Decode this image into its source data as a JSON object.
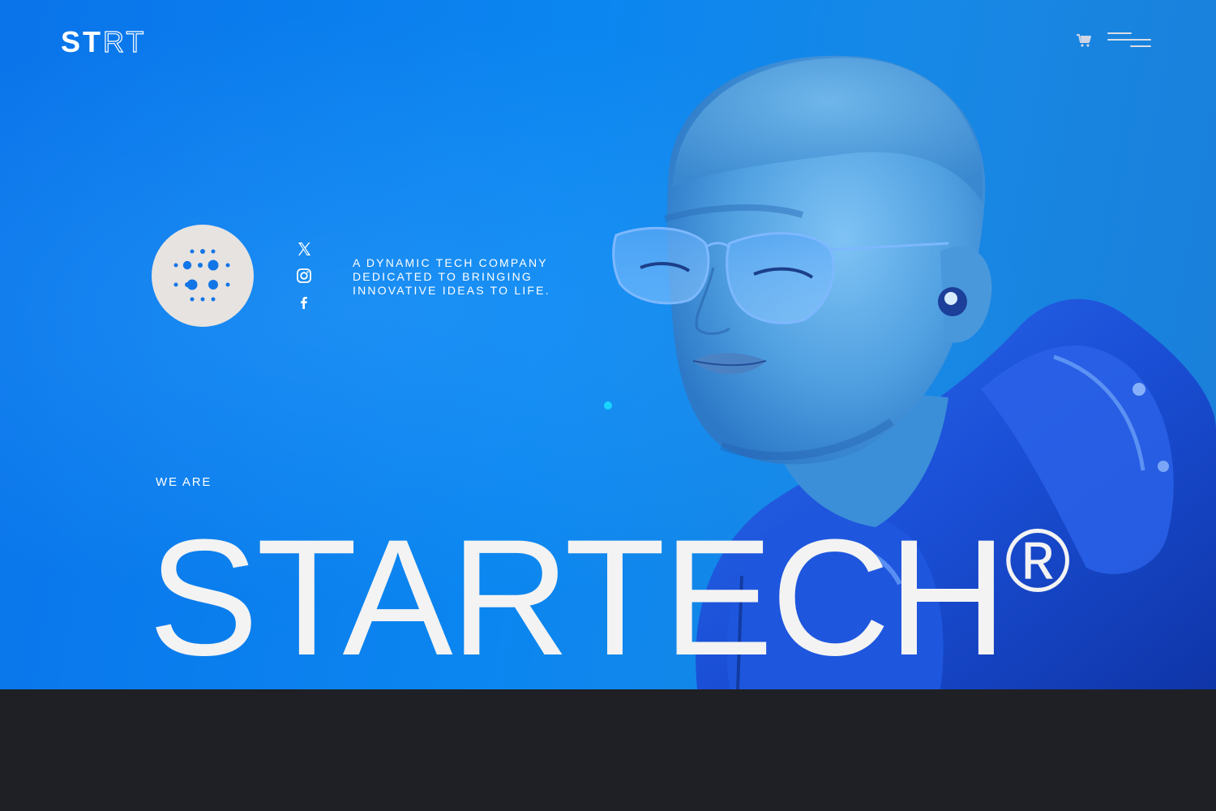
{
  "brand": {
    "logo_solid": "ST",
    "logo_outline": "RT"
  },
  "header": {
    "cart_icon": "cart-icon",
    "menu_icon": "hamburger-menu-icon"
  },
  "hero": {
    "tagline": "A DYNAMIC TECH COMPANY DEDICATED TO BRINGING INNOVATIVE IDEAS TO LIFE.",
    "eyebrow": "WE ARE",
    "headline": "STARTECH",
    "headline_mark": "®",
    "image": "portrait-of-person-in-blue-sunglasses-and-jacket-with-earbud"
  },
  "socials": [
    {
      "name": "x-icon"
    },
    {
      "name": "instagram-icon"
    },
    {
      "name": "facebook-icon"
    }
  ],
  "colors": {
    "hero_blue": "#0a7ff0",
    "badge_bg": "#e7e3e0",
    "badge_dots": "#1276e6",
    "footer_band": "#1e2025",
    "accent_dot": "#19d4ff",
    "text": "#f3f3f3"
  }
}
